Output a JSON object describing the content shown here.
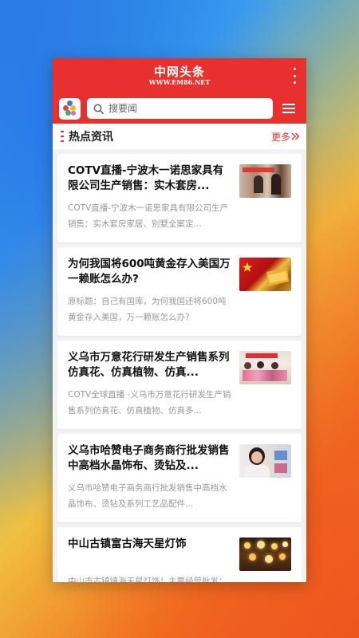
{
  "header": {
    "title": "中网头条",
    "url": "WWW.EM86.NET"
  },
  "search": {
    "placeholder": "搜要闻"
  },
  "section": {
    "title": "热点资讯",
    "more_label": "更多"
  },
  "articles": [
    {
      "title": "COTV直播-宁波木一诺思家具有限公司生产销售：实木套房...",
      "desc": "COTV直播-宁波木一诺思家具有限公司生产销售：实木套房家居、别墅全案定..."
    },
    {
      "title": "为何我国将600吨黄金存入美国万一赖账怎么办?",
      "desc": "原标题：自己有国库，为何我国还将600吨黄金存入美国，万一赖账怎么办?"
    },
    {
      "title": "义乌市万意花行研发生产销售系列仿真花、仿真植物、仿真...",
      "desc": "COTV全球直播 -义乌市万意花行研发生产销售系列仿真花、仿真植物、仿真多..."
    },
    {
      "title": "义乌市哈赞电子商务商行批发销售中高档水晶饰布、烫钻及...",
      "desc": "义乌市哈赞电子商务商行批发销售中高档水晶饰布、烫钻及系列工艺品配件..."
    },
    {
      "title": "中山古镇富古海天星灯饰",
      "desc": "中山市古镇镇海天星灯饰！主要经营批发：中式灯、羊皮灯、餐吊灯卧室灯等..."
    }
  ],
  "colors": {
    "brand_red": "#e8312f"
  }
}
